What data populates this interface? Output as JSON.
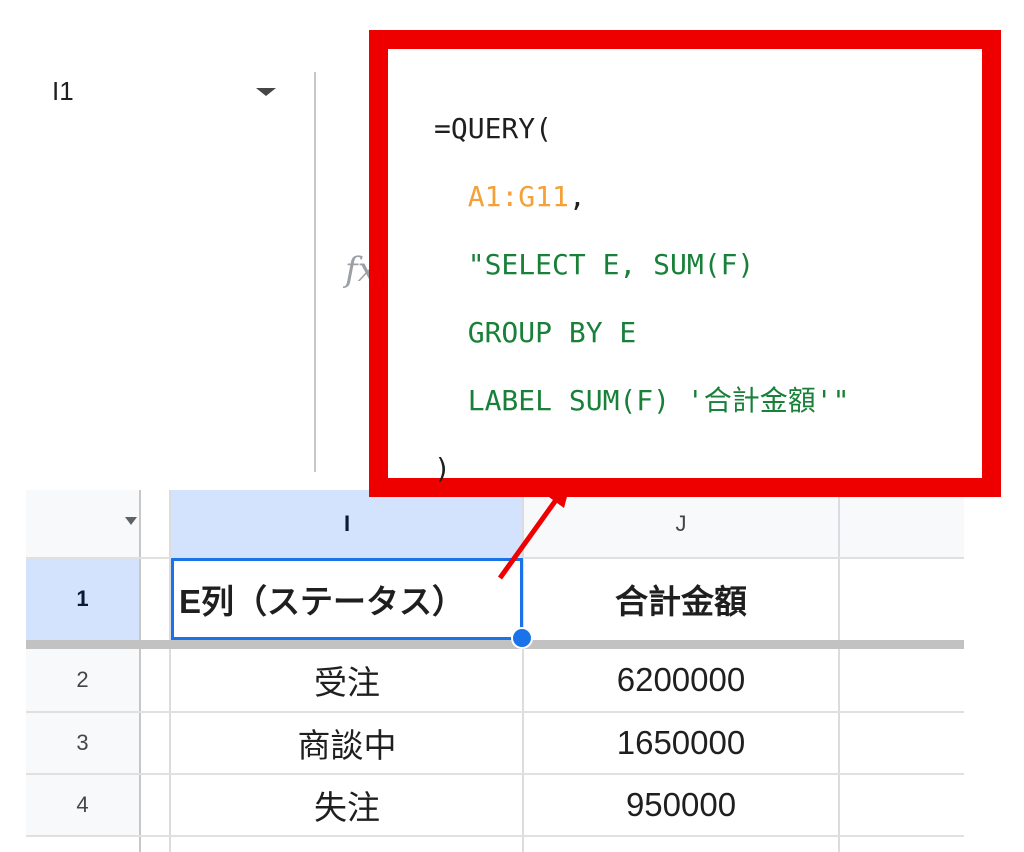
{
  "name_box": {
    "value": "I1"
  },
  "formula_bar": {
    "fx_label": "fx",
    "lines": [
      [
        {
          "text": "=QUERY(",
          "color": "black"
        }
      ],
      [
        {
          "text": "  ",
          "color": "black"
        },
        {
          "text": "A1:G11",
          "color": "orange"
        },
        {
          "text": ",",
          "color": "black"
        }
      ],
      [
        {
          "text": "  \"SELECT E, SUM(F)",
          "color": "green"
        }
      ],
      [
        {
          "text": "  GROUP BY E",
          "color": "green"
        }
      ],
      [
        {
          "text": "  LABEL SUM(F) '合計金額'\"",
          "color": "green"
        }
      ],
      [
        {
          "text": ")",
          "color": "black"
        }
      ]
    ]
  },
  "grid": {
    "columns": [
      "I",
      "J"
    ],
    "rows": [
      {
        "number": "1",
        "cells": [
          "E列（ステータス）",
          "合計金額"
        ]
      },
      {
        "number": "2",
        "cells": [
          "受注",
          "6200000"
        ]
      },
      {
        "number": "3",
        "cells": [
          "商談中",
          "1650000"
        ]
      },
      {
        "number": "4",
        "cells": [
          "失注",
          "950000"
        ]
      }
    ]
  },
  "colors": {
    "highlight_border": "#ee0000",
    "selection": "#1a73e8",
    "header_selected": "#d3e3fd",
    "range_ref": "#f4a13a",
    "string_literal": "#188038"
  }
}
